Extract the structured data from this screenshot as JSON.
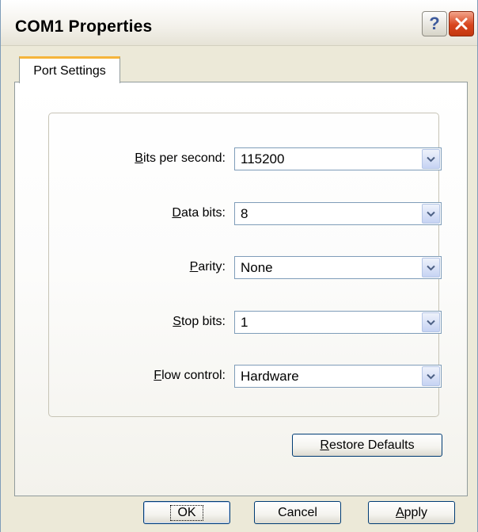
{
  "window": {
    "title": "COM1 Properties"
  },
  "titlebar": {
    "help_glyph": "?",
    "help_icon": "question-mark-icon",
    "close_icon": "close-x-icon"
  },
  "tabs": [
    {
      "label": "Port Settings",
      "active": true
    }
  ],
  "settings": [
    {
      "label_mnemonic": "B",
      "label_rest": "its per second:",
      "value": "115200"
    },
    {
      "label_mnemonic": "D",
      "label_rest": "ata bits:",
      "value": "8"
    },
    {
      "label_mnemonic": "P",
      "label_rest": "arity:",
      "value": "None"
    },
    {
      "label_mnemonic": "S",
      "label_rest": "top bits:",
      "value": "1"
    },
    {
      "label_mnemonic": "F",
      "label_rest": "low control:",
      "value": "Hardware"
    }
  ],
  "buttons": {
    "restore_mnemonic": "R",
    "restore_rest": "estore Defaults",
    "ok_label": "OK",
    "cancel_label": "Cancel",
    "apply_mnemonic": "A",
    "apply_rest": "pply"
  },
  "colors": {
    "tab_accent": "#f5b43b",
    "close_red": "#d8451d",
    "dialog_bg": "#ece9d8"
  }
}
